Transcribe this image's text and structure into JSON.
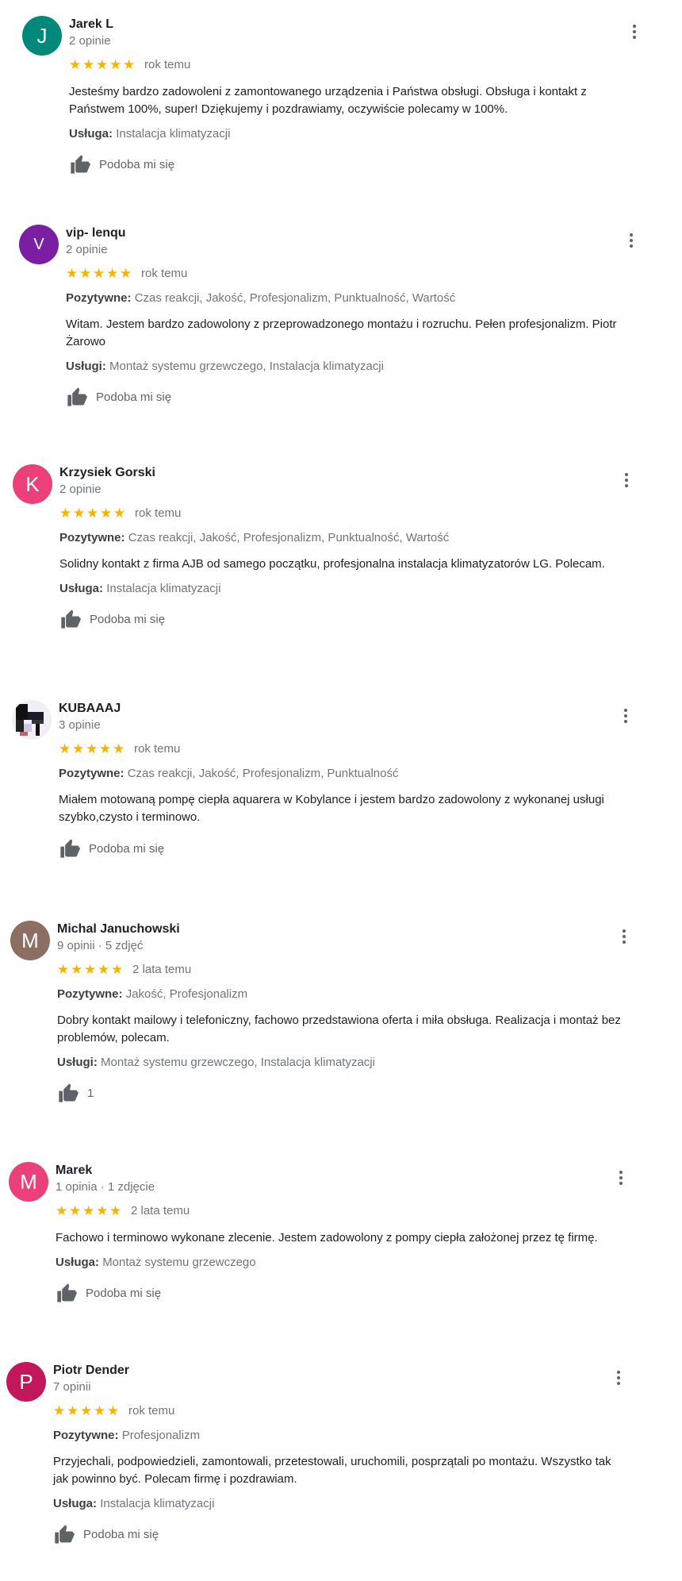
{
  "like_label": "Podoba mi się",
  "reviews": [
    {
      "name": "Jarek L",
      "meta": "2 opinie",
      "avatar_letter": "J",
      "avatar_color": "#00897b",
      "rating": 5,
      "time": "rok temu",
      "positive_label": "",
      "positive_value": "",
      "text": "Jesteśmy bardzo zadowoleni z zamontowanego urządzenia i Państwa obsługi.  Obsługa i kontakt z Państwem 100%, super! Dziękujemy i pozdrawiamy, oczywiście polecamy w 100%.",
      "service_label": "Usługa:",
      "service_value": "Instalacja klimatyzacji",
      "likes": "Podoba mi się"
    },
    {
      "name": "vip- lenqu",
      "meta": "2 opinie",
      "avatar_letter": "V",
      "avatar_color": "#7b1fa2",
      "rating": 5,
      "time": "rok temu",
      "positive_label": "Pozytywne:",
      "positive_value": "Czas reakcji, Jakość, Profesjonalizm, Punktualność, Wartość",
      "text": "Witam. Jestem bardzo zadowolony z przeprowadzonego montażu i rozruchu. Pełen profesjonalizm. Piotr Żarowo",
      "service_label": "Usługi:",
      "service_value": "Montaż systemu grzewczego, Instalacja klimatyzacji",
      "likes": "Podoba mi się"
    },
    {
      "name": "Krzysiek Gorski",
      "meta": "2 opinie",
      "avatar_letter": "K",
      "avatar_color": "#ec407a",
      "rating": 5,
      "time": "rok temu",
      "positive_label": "Pozytywne:",
      "positive_value": "Czas reakcji, Jakość, Profesjonalizm, Punktualność, Wartość",
      "text": "Solidny kontakt z firma AJB od samego początku, profesjonalna instalacja klimatyzatorów LG. Polecam.",
      "service_label": "Usługa:",
      "service_value": "Instalacja klimatyzacji",
      "likes": "Podoba mi się"
    },
    {
      "name": "KUBAAAJ",
      "meta": "3 opinie",
      "avatar_letter": "",
      "avatar_color": "#f3f0f5",
      "rating": 5,
      "time": "rok temu",
      "positive_label": "Pozytywne:",
      "positive_value": "Czas reakcji, Jakość, Profesjonalizm, Punktualność",
      "text": "Miałem motowaną pompę ciepła aquarera w Kobylance i jestem bardzo zadowolony z wykonanej usługi szybko,czysto i terminowo.",
      "service_label": "",
      "service_value": "",
      "likes": "Podoba mi się"
    },
    {
      "name": "Michal Januchowski",
      "meta": "9 opinii · 5 zdjęć",
      "avatar_letter": "M",
      "avatar_color": "#8d6e63",
      "rating": 5,
      "time": "2 lata temu",
      "positive_label": "Pozytywne:",
      "positive_value": "Jakość, Profesjonalizm",
      "text": "Dobry kontakt mailowy i telefoniczny, fachowo przedstawiona oferta i miła obsługa. Realizacja i montaż bez problemów, polecam.",
      "service_label": "Usługi:",
      "service_value": "Montaż systemu grzewczego, Instalacja klimatyzacji",
      "likes": "1"
    },
    {
      "name": "Marek",
      "meta": "1 opinia · 1 zdjęcie",
      "avatar_letter": "M",
      "avatar_color": "#ec407a",
      "rating": 5,
      "time": "2 lata temu",
      "positive_label": "",
      "positive_value": "",
      "text": "Fachowo i terminowo wykonane zlecenie. Jestem zadowolony z pompy ciepła założonej przez tę firmę.",
      "service_label": "Usługa:",
      "service_value": "Montaż systemu grzewczego",
      "likes": "Podoba mi się"
    },
    {
      "name": "Piotr Dender",
      "meta": "7 opinii",
      "avatar_letter": "P",
      "avatar_color": "#c2185b",
      "rating": 5,
      "time": "rok temu",
      "positive_label": "Pozytywne:",
      "positive_value": "Profesjonalizm",
      "text": "Przyjechali, podpowiedzieli, zamontowali, przetestowali, uruchomili, posprzątali po montażu. Wszystko tak jak powinno być. Polecam firmę i pozdrawiam.",
      "service_label": "Usługa:",
      "service_value": "Instalacja klimatyzacji",
      "likes": "Podoba mi się"
    }
  ]
}
